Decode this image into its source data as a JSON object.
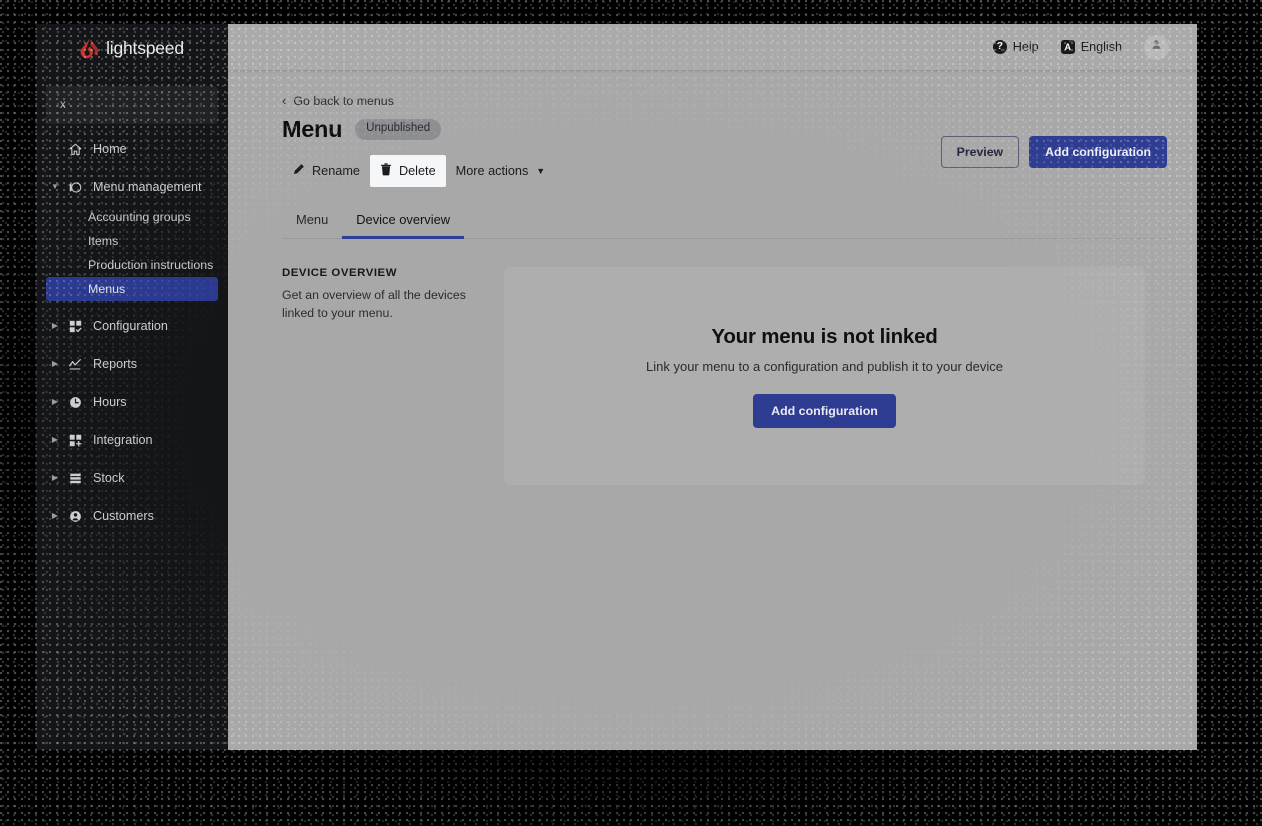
{
  "sidebar": {
    "brand": "lightspeed",
    "search_value": "x",
    "items": [
      {
        "label": "Home",
        "icon": "home-icon",
        "expandable": false,
        "caret": ""
      },
      {
        "label": "Menu management",
        "icon": "menu-management-icon",
        "expandable": true,
        "caret": "▼"
      },
      {
        "label": "Configuration",
        "icon": "configuration-icon",
        "expandable": true,
        "caret": "▶"
      },
      {
        "label": "Reports",
        "icon": "reports-icon",
        "expandable": true,
        "caret": "▶"
      },
      {
        "label": "Hours",
        "icon": "hours-icon",
        "expandable": true,
        "caret": "▶"
      },
      {
        "label": "Integration",
        "icon": "integration-icon",
        "expandable": true,
        "caret": "▶"
      },
      {
        "label": "Stock",
        "icon": "stock-icon",
        "expandable": true,
        "caret": "▶"
      },
      {
        "label": "Customers",
        "icon": "customers-icon",
        "expandable": true,
        "caret": "▶"
      }
    ],
    "sub_items": [
      {
        "label": "Accounting groups",
        "active": false
      },
      {
        "label": "Items",
        "active": false
      },
      {
        "label": "Production instructions",
        "active": false
      },
      {
        "label": "Menus",
        "active": true
      }
    ]
  },
  "topbar": {
    "help_label": "Help",
    "help_icon": "question-mark-circle-icon",
    "language_label": "English",
    "language_icon": "translate-icon",
    "language_icon_glyph": "A",
    "avatar_icon": "user-avatar-icon"
  },
  "main": {
    "back_link": "Go back to menus",
    "back_chevron": "‹",
    "page_title": "Menu",
    "status_badge": "Unpublished",
    "header_buttons": {
      "preview": "Preview",
      "add_configuration": "Add configuration"
    },
    "actions": [
      {
        "label": "Rename",
        "icon": "pencil-icon",
        "glyph": "✎",
        "hovered": false,
        "has_caret": false
      },
      {
        "label": "Delete",
        "icon": "trash-icon",
        "glyph": "🗑",
        "hovered": true,
        "has_caret": false
      },
      {
        "label": "More actions",
        "icon": "chevron-down-icon",
        "glyph": "",
        "hovered": false,
        "has_caret": true,
        "caret": "▼"
      }
    ],
    "tabs": [
      {
        "label": "Menu",
        "active": false
      },
      {
        "label": "Device overview",
        "active": true
      }
    ],
    "section": {
      "kicker": "DEVICE OVERVIEW",
      "description": "Get an overview of all the devices linked to your menu."
    },
    "empty_state": {
      "title": "Your menu is not linked",
      "subtitle": "Link your menu to a configuration and publish it to your device",
      "cta": "Add configuration"
    }
  },
  "colors": {
    "sidebar_bg": "#141518",
    "sidebar_active": "#2b3a8f",
    "brand_red": "#c8322b",
    "accent_blue": "#2e3c92",
    "app_bg": "#a8a8a9",
    "card_bg": "#aeaeaf",
    "badge_bg": "#8d8e91"
  }
}
